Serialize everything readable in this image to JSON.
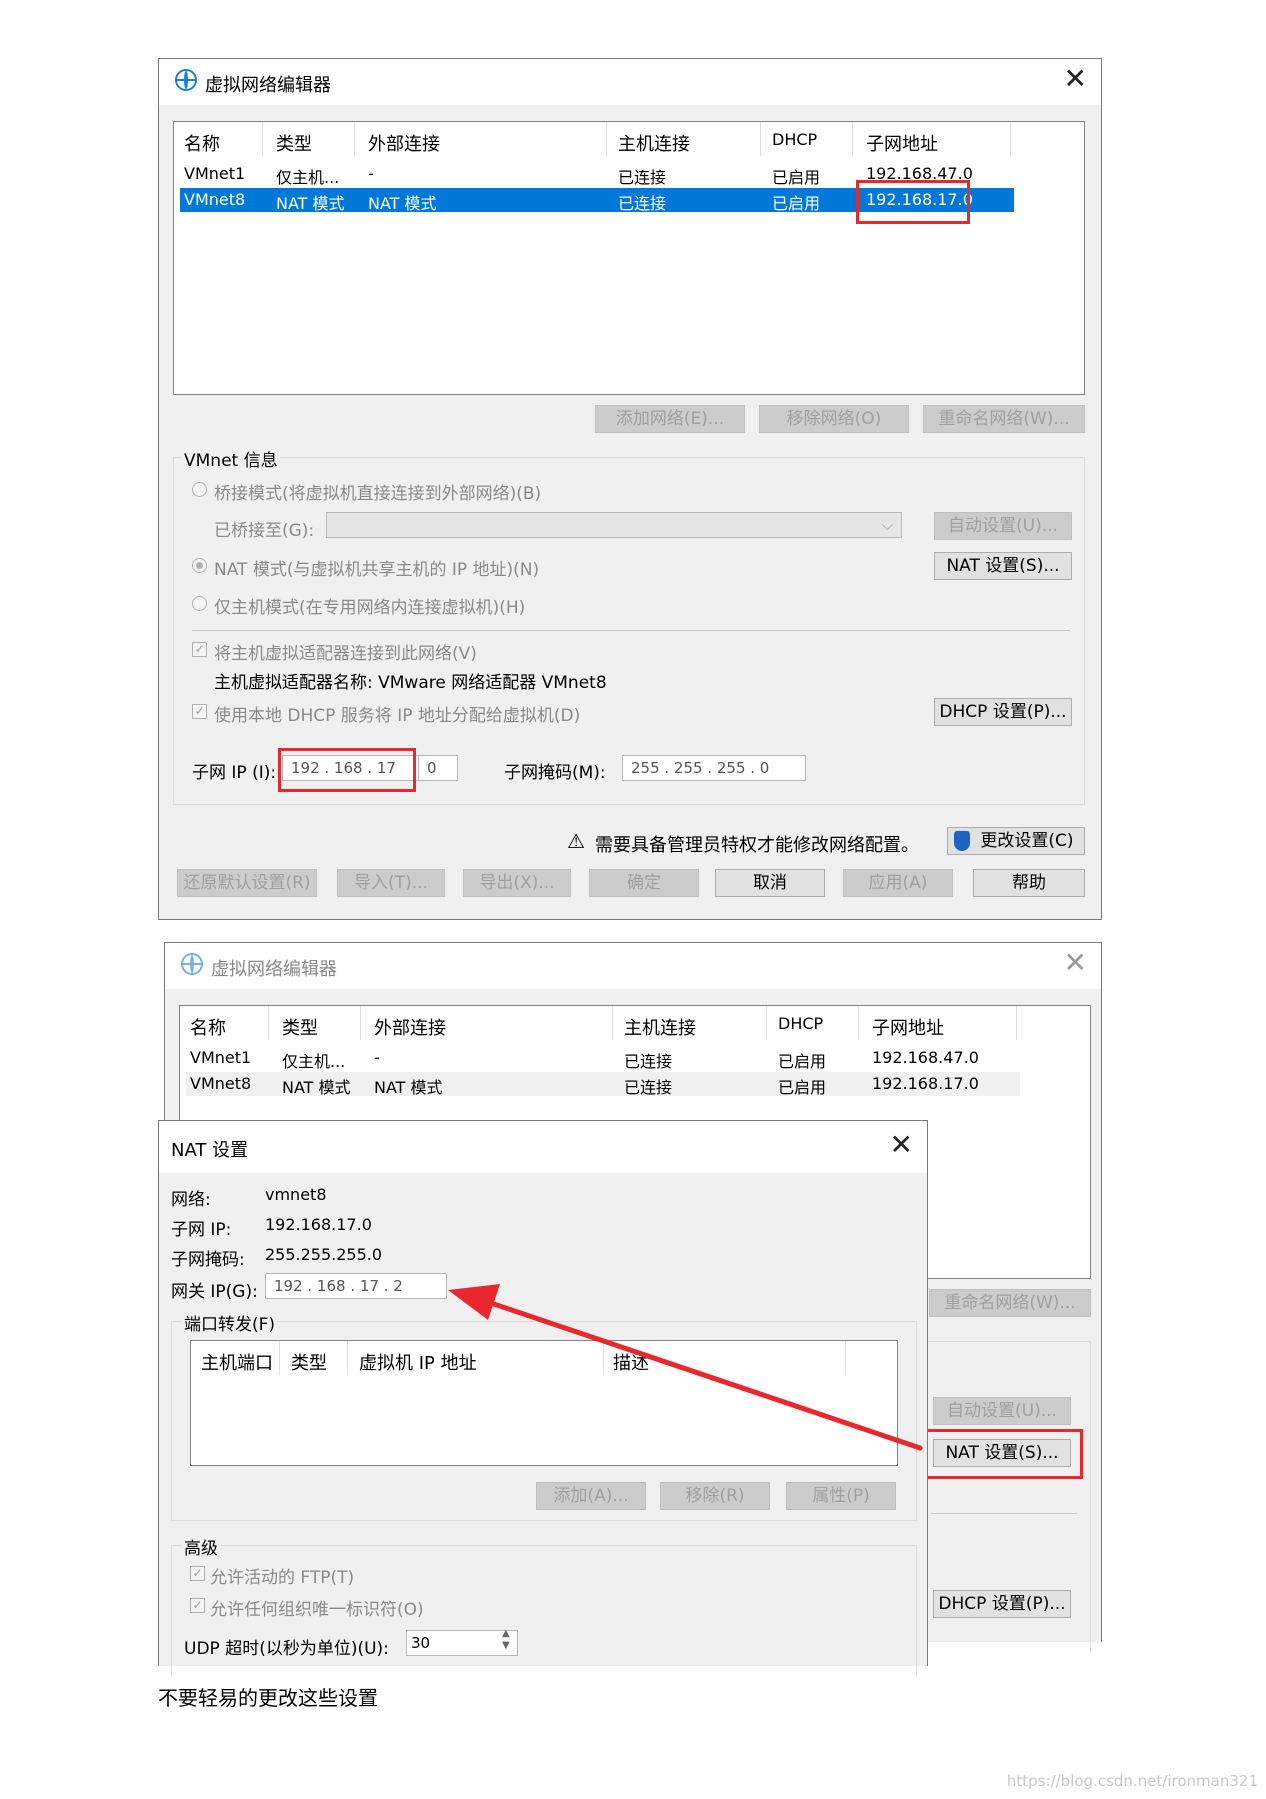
{
  "dialog1": {
    "title": "虚拟网络编辑器",
    "columns": [
      "名称",
      "类型",
      "外部连接",
      "主机连接",
      "DHCP",
      "子网地址"
    ],
    "rows": [
      [
        "VMnet1",
        "仅主机...",
        "-",
        "已连接",
        "已启用",
        "192.168.47.0"
      ],
      [
        "VMnet8",
        "NAT 模式",
        "NAT 模式",
        "已连接",
        "已启用",
        "192.168.17.0"
      ]
    ],
    "buttons": {
      "add_network": "添加网络(E)...",
      "remove_network": "移除网络(O)",
      "rename_network": "重命名网络(W)..."
    },
    "vmnet_info": {
      "group_label": "VMnet 信息",
      "bridge_mode": "桥接模式(将虚拟机直接连接到外部网络)(B)",
      "bridged_to_label": "已桥接至(G):",
      "auto_settings": "自动设置(U)...",
      "nat_mode": "NAT 模式(与虚拟机共享主机的 IP 地址)(N)",
      "nat_settings": "NAT 设置(S)...",
      "host_only_mode": "仅主机模式(在专用网络内连接虚拟机)(H)",
      "connect_adapter": "将主机虚拟适配器连接到此网络(V)",
      "adapter_name": "主机虚拟适配器名称: VMware 网络适配器 VMnet8",
      "use_dhcp": "使用本地 DHCP 服务将 IP 地址分配给虚拟机(D)",
      "dhcp_settings": "DHCP 设置(P)...",
      "subnet_ip_label": "子网 IP (I):",
      "subnet_ip_value": "192 . 168 . 17",
      "subnet_ip_last": "0",
      "subnet_mask_label": "子网掩码(M):",
      "subnet_mask_value": "255 . 255 . 255 . 0"
    },
    "admin_warning": "需要具备管理员特权才能修改网络配置。",
    "change_settings": "更改设置(C)",
    "bottom_buttons": {
      "restore": "还原默认设置(R)",
      "import": "导入(T)...",
      "export": "导出(X)...",
      "ok": "确定",
      "cancel": "取消",
      "apply": "应用(A)",
      "help": "帮助"
    }
  },
  "dialog2": {
    "title": "虚拟网络编辑器",
    "columns": [
      "名称",
      "类型",
      "外部连接",
      "主机连接",
      "DHCP",
      "子网地址"
    ],
    "rows": [
      [
        "VMnet1",
        "仅主机...",
        "-",
        "已连接",
        "已启用",
        "192.168.47.0"
      ],
      [
        "VMnet8",
        "NAT 模式",
        "NAT 模式",
        "已连接",
        "已启用",
        "192.168.17.0"
      ]
    ],
    "rename_network": "重命名网络(W)...",
    "auto_settings": "自动设置(U)...",
    "nat_settings": "NAT 设置(S)...",
    "dhcp_settings": "DHCP 设置(P)..."
  },
  "nat_dialog": {
    "title": "NAT 设置",
    "network_label": "网络:",
    "network_value": "vmnet8",
    "subnet_ip_label": "子网 IP:",
    "subnet_ip_value": "192.168.17.0",
    "subnet_mask_label": "子网掩码:",
    "subnet_mask_value": "255.255.255.0",
    "gateway_label": "网关 IP(G):",
    "gateway_value": "192 . 168 . 17 . 2",
    "port_forward_label": "端口转发(F)",
    "pf_columns": [
      "主机端口",
      "类型",
      "虚拟机 IP 地址",
      "描述"
    ],
    "pf_buttons": {
      "add": "添加(A)...",
      "remove": "移除(R)",
      "properties": "属性(P)"
    },
    "advanced_label": "高级",
    "allow_ftp": "允许活动的 FTP(T)",
    "allow_uid": "允许任何组织唯一标识符(O)",
    "udp_timeout_label": "UDP 超时(以秒为单位)(U):",
    "udp_timeout_value": "30"
  },
  "caption": "不要轻易的更改这些设置",
  "watermark": "https://blog.csdn.net/ironman321",
  "colors": {
    "selection": "#0078d7",
    "highlight_red": "#e8282d",
    "dialog_bg": "#f0f0f0"
  }
}
